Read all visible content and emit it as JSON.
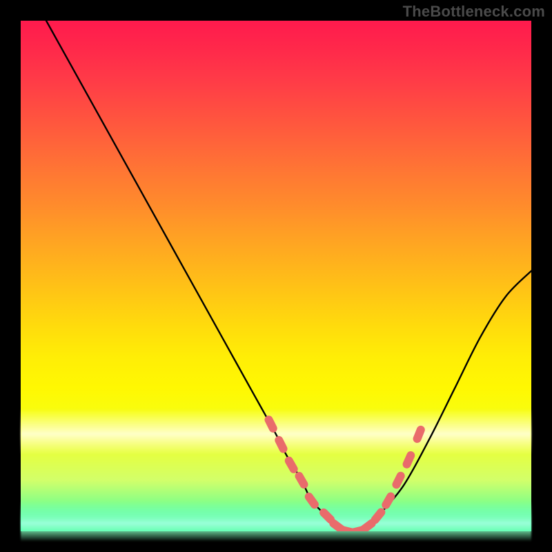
{
  "watermark": {
    "text": "TheBottleneck.com"
  },
  "colors": {
    "frame_bg": "#000000",
    "curve_stroke": "#000000",
    "marker_fill": "#e96b6b",
    "gradient_top": "#ff1a4d",
    "gradient_bottom": "#1cffa8"
  },
  "chart_data": {
    "type": "line",
    "title": "",
    "xlabel": "",
    "ylabel": "",
    "x_range": [
      0,
      100
    ],
    "y_range": [
      0,
      100
    ],
    "grid": false,
    "legend": false,
    "series": [
      {
        "name": "bottleneck-curve",
        "x": [
          5,
          10,
          15,
          20,
          25,
          30,
          35,
          40,
          45,
          50,
          52,
          55,
          57,
          60,
          63,
          65,
          68,
          70,
          75,
          80,
          85,
          90,
          95,
          100
        ],
        "y": [
          100,
          91,
          82,
          73,
          64,
          55,
          46,
          37,
          28,
          19,
          15,
          10,
          6,
          3,
          1,
          0,
          1,
          3,
          9,
          18,
          28,
          38,
          46,
          51
        ]
      }
    ],
    "markers": {
      "name": "highlighted-points",
      "x": [
        49,
        51,
        53,
        55,
        57,
        60,
        62,
        64,
        66,
        68,
        70,
        72,
        74,
        76,
        78
      ],
      "y": [
        21,
        17,
        13,
        10,
        6,
        3,
        1,
        0,
        0,
        1,
        3,
        6,
        10,
        14,
        19
      ]
    }
  }
}
